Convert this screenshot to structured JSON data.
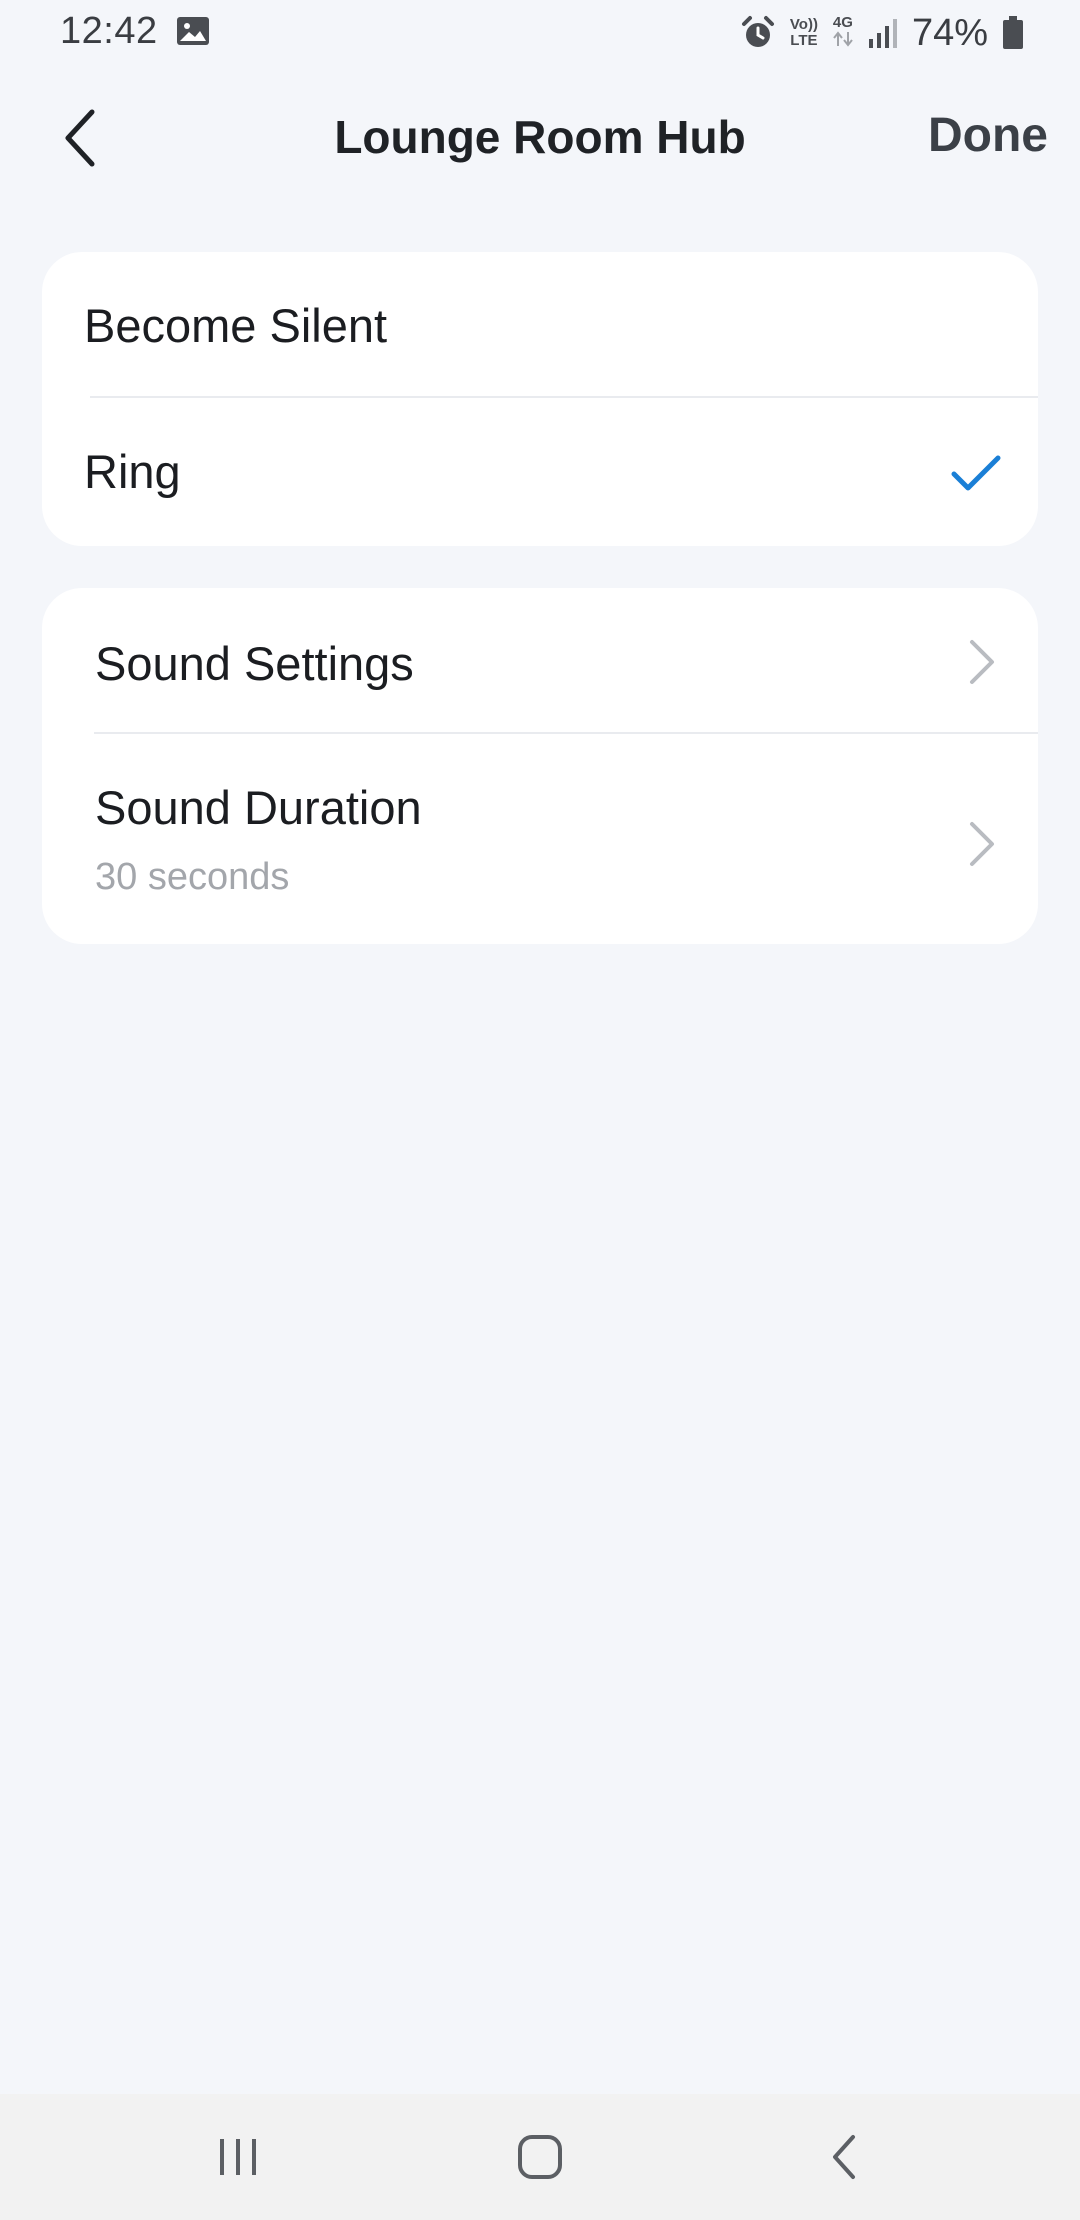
{
  "status_bar": {
    "time": "12:42",
    "gallery_icon": "image-icon",
    "alarm_icon": "alarm-icon",
    "volte_top": "Vo))",
    "volte_bottom": "LTE",
    "network": "4G",
    "signal_icon": "signal-icon",
    "battery_percent": "74%",
    "battery_icon": "battery-icon"
  },
  "header": {
    "back_icon": "chevron-left-icon",
    "title": "Lounge Room Hub",
    "done_label": "Done"
  },
  "mode_options": [
    {
      "label": "Become Silent",
      "selected": false
    },
    {
      "label": "Ring",
      "selected": true
    }
  ],
  "sound_items": [
    {
      "label": "Sound Settings",
      "value": ""
    },
    {
      "label": "Sound Duration",
      "value": "30 seconds"
    }
  ],
  "nav_bar": {
    "recents_icon": "recents-icon",
    "home_icon": "home-icon",
    "back_icon": "back-icon"
  },
  "colors": {
    "background": "#f4f6fa",
    "card": "#ffffff",
    "accent_check": "#1a7fd6",
    "chevron": "#b9bcc1",
    "subtext": "#a3a6ab"
  }
}
